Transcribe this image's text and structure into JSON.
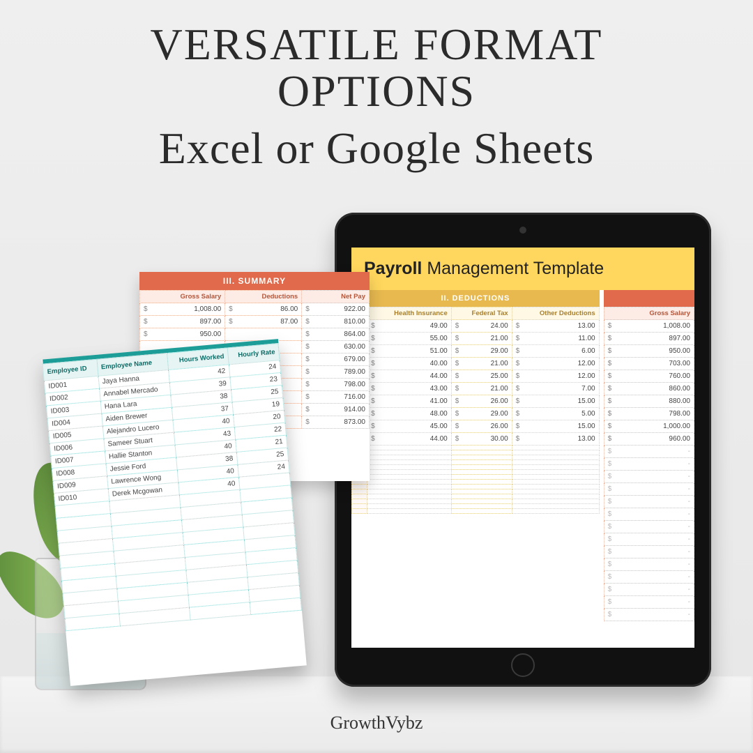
{
  "heading": {
    "line1": "VERSATILE FORMAT",
    "line2": "OPTIONS",
    "sub": "Excel or Google Sheets"
  },
  "footer": "GrowthVybz",
  "tablet": {
    "title_bold": "Payroll",
    "title_rest": " Management Template",
    "ded_band": "II.   DEDUCTIONS",
    "gross_band": "",
    "ded_headers": [
      "Health Insurance",
      "Federal Tax",
      "Other Deductions"
    ],
    "gross_header": "Gross Salary",
    "stubs": [
      "24",
      "23",
      "25",
      "19",
      "20",
      "20",
      "22",
      "21",
      "25",
      "24"
    ],
    "rows": [
      {
        "hi": "49.00",
        "ft": "24.00",
        "od": "13.00",
        "gs": "1,008.00"
      },
      {
        "hi": "55.00",
        "ft": "21.00",
        "od": "11.00",
        "gs": "897.00"
      },
      {
        "hi": "51.00",
        "ft": "29.00",
        "od": "6.00",
        "gs": "950.00"
      },
      {
        "hi": "40.00",
        "ft": "21.00",
        "od": "12.00",
        "gs": "703.00"
      },
      {
        "hi": "44.00",
        "ft": "25.00",
        "od": "12.00",
        "gs": "760.00"
      },
      {
        "hi": "43.00",
        "ft": "21.00",
        "od": "7.00",
        "gs": "860.00"
      },
      {
        "hi": "41.00",
        "ft": "26.00",
        "od": "15.00",
        "gs": "880.00"
      },
      {
        "hi": "48.00",
        "ft": "29.00",
        "od": "5.00",
        "gs": "798.00"
      },
      {
        "hi": "45.00",
        "ft": "26.00",
        "od": "15.00",
        "gs": "1,000.00"
      },
      {
        "hi": "44.00",
        "ft": "30.00",
        "od": "13.00",
        "gs": "960.00"
      }
    ],
    "blank_rows": 14,
    "dash": "-"
  },
  "summary": {
    "band": "III.   SUMMARY",
    "headers": [
      "Gross Salary",
      "Deductions",
      "Net Pay"
    ],
    "rows": [
      {
        "gs": "1,008.00",
        "d": "86.00",
        "np": "922.00"
      },
      {
        "gs": "897.00",
        "d": "87.00",
        "np": "810.00"
      },
      {
        "gs": "950.00",
        "d": "",
        "np": "864.00"
      },
      {
        "gs": "",
        "d": "",
        "np": "630.00"
      },
      {
        "gs": "",
        "d": "",
        "np": "679.00"
      },
      {
        "gs": "",
        "d": "",
        "np": "789.00"
      },
      {
        "gs": "",
        "d": "",
        "np": "798.00"
      },
      {
        "gs": "",
        "d": "",
        "np": "716.00"
      },
      {
        "gs": "",
        "d": "",
        "np": "914.00"
      },
      {
        "gs": "",
        "d": "",
        "np": "873.00"
      }
    ]
  },
  "employees": {
    "headers": [
      "Employee ID",
      "Employee Name",
      "Hours Worked",
      "Hourly Rate"
    ],
    "rows": [
      {
        "id": "ID001",
        "name": "Jaya Hanna",
        "hw": "42",
        "hr": "24"
      },
      {
        "id": "ID002",
        "name": "Annabel Mercado",
        "hw": "39",
        "hr": "23"
      },
      {
        "id": "ID003",
        "name": "Hana Lara",
        "hw": "38",
        "hr": "25"
      },
      {
        "id": "ID004",
        "name": "Aiden Brewer",
        "hw": "37",
        "hr": "19"
      },
      {
        "id": "ID005",
        "name": "Alejandro Lucero",
        "hw": "40",
        "hr": "20"
      },
      {
        "id": "ID006",
        "name": "Sameer Stuart",
        "hw": "43",
        "hr": "22"
      },
      {
        "id": "ID007",
        "name": "Hallie Stanton",
        "hw": "40",
        "hr": "21"
      },
      {
        "id": "ID008",
        "name": "Jessie Ford",
        "hw": "38",
        "hr": "25"
      },
      {
        "id": "ID009",
        "name": "Lawrence Wong",
        "hw": "40",
        "hr": "24"
      },
      {
        "id": "ID010",
        "name": "Derek Mcgowan",
        "hw": "40",
        "hr": ""
      }
    ],
    "blank_rows": 10
  }
}
